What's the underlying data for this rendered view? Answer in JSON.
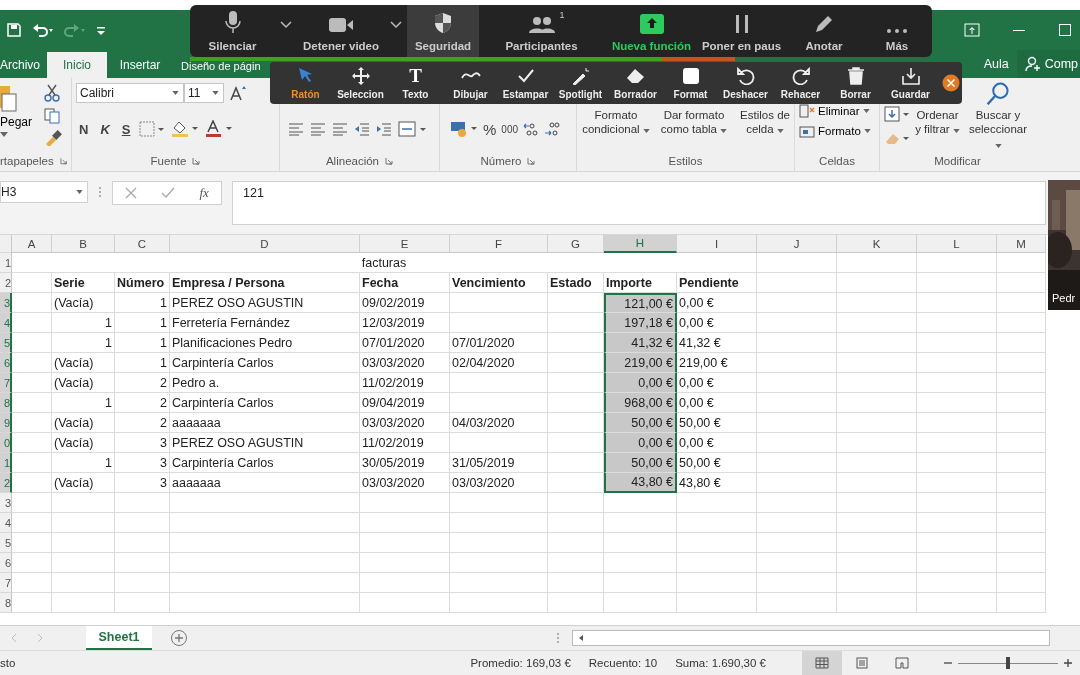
{
  "title_bar": {
    "right_items": [
      "Aula",
      "Comp"
    ]
  },
  "ribbon": {
    "tabs": [
      {
        "label": "Archivo",
        "selected": false
      },
      {
        "label": "Inicio",
        "selected": true
      },
      {
        "label": "Insertar",
        "selected": false
      },
      {
        "label": "Diseño de págin",
        "selected": false
      }
    ],
    "groups": [
      {
        "kind": "clipboard",
        "label": "rtapapeles",
        "launcher": true
      },
      {
        "kind": "font",
        "label": "Fuente",
        "launcher": true
      },
      {
        "kind": "align",
        "label": "Alineación",
        "launcher": true
      },
      {
        "kind": "number",
        "label": "Número",
        "launcher": true
      },
      {
        "kind": "styles",
        "label": "Estilos",
        "launcher": false
      },
      {
        "kind": "cells",
        "label": "Celdas",
        "launcher": false
      },
      {
        "kind": "editing",
        "label": "Modificar",
        "launcher": false
      }
    ],
    "paste": "Pegar",
    "font": {
      "name": "Calibri",
      "size": "11",
      "bold": "N",
      "italic": "K",
      "underline": "S"
    },
    "number": {
      "percent": "%",
      "thousands": "000"
    },
    "styles": [
      "Formato condicional",
      "Dar formato como tabla",
      "Estilos de celda"
    ],
    "cells": [
      "Eliminar",
      "Formato"
    ],
    "editing": [
      "Ordenar y filtrar",
      "Buscar y seleccionar"
    ]
  },
  "formula_bar": {
    "name_box": "H3",
    "fx": "fx",
    "value": "121"
  },
  "sheet": {
    "columns": [
      {
        "label": "A",
        "selected": false
      },
      {
        "label": "B",
        "selected": false
      },
      {
        "label": "C",
        "selected": false
      },
      {
        "label": "D",
        "selected": false
      },
      {
        "label": "E",
        "selected": false
      },
      {
        "label": "F",
        "selected": false
      },
      {
        "label": "G",
        "selected": false
      },
      {
        "label": "H",
        "selected": true
      },
      {
        "label": "I",
        "selected": false
      },
      {
        "label": "J",
        "selected": false
      },
      {
        "label": "K",
        "selected": false
      },
      {
        "label": "L",
        "selected": false
      },
      {
        "label": "M",
        "selected": false
      }
    ],
    "title_row": {
      "number": "1",
      "text": "facturas"
    },
    "header_row": {
      "number": "2",
      "cells": [
        "Serie",
        "Número",
        "Empresa / Persona",
        "Fecha",
        "Vencimiento",
        "Estado",
        "Importe",
        "Pendiente"
      ]
    },
    "rows": [
      {
        "number": "3",
        "serie": {
          "value": "(Vacía)",
          "kind": "text"
        },
        "numero": "1",
        "empresa": "PEREZ OSO AGUSTIN",
        "fecha": "09/02/2019",
        "importe": "121,00 €",
        "pendiente": "0,00 €",
        "selected": true
      },
      {
        "number": "4",
        "serie": {
          "value": "1",
          "kind": "number"
        },
        "numero": "1",
        "empresa": "Ferretería Fernández",
        "fecha": "12/03/2019",
        "importe": "197,18 €",
        "pendiente": "0,00 €",
        "selected": true
      },
      {
        "number": "5",
        "serie": {
          "value": "1",
          "kind": "number"
        },
        "numero": "1",
        "empresa": "Planificaciones Pedro",
        "fecha": "07/01/2020",
        "vencimiento": "07/01/2020",
        "importe": "41,32 €",
        "pendiente": "41,32 €",
        "selected": true
      },
      {
        "number": "6",
        "serie": {
          "value": "(Vacía)",
          "kind": "text"
        },
        "numero": "1",
        "empresa": "Carpintería Carlos",
        "fecha": "03/03/2020",
        "vencimiento": "02/04/2020",
        "importe": "219,00 €",
        "pendiente": "219,00 €",
        "selected": true
      },
      {
        "number": "7",
        "serie": {
          "value": "(Vacía)",
          "kind": "text"
        },
        "numero": "2",
        "empresa": "Pedro a.",
        "fecha": "11/02/2019",
        "importe": "0,00 €",
        "pendiente": "0,00 €",
        "selected": true
      },
      {
        "number": "8",
        "serie": {
          "value": "1",
          "kind": "number"
        },
        "numero": "2",
        "empresa": "Carpintería Carlos",
        "fecha": "09/04/2019",
        "importe": "968,00 €",
        "pendiente": "0,00 €",
        "selected": true
      },
      {
        "number": "9",
        "serie": {
          "value": "(Vacía)",
          "kind": "text"
        },
        "numero": "2",
        "empresa": "aaaaaaa",
        "fecha": "03/03/2020",
        "vencimiento": "04/03/2020",
        "importe": "50,00 €",
        "pendiente": "50,00 €",
        "selected": true
      },
      {
        "number": "0",
        "serie": {
          "value": "(Vacía)",
          "kind": "text"
        },
        "numero": "3",
        "empresa": "PEREZ OSO AGUSTIN",
        "fecha": "11/02/2019",
        "importe": "0,00 €",
        "pendiente": "0,00 €",
        "selected": true
      },
      {
        "number": "1",
        "serie": {
          "value": "1",
          "kind": "number"
        },
        "numero": "3",
        "empresa": "Carpintería Carlos",
        "fecha": "30/05/2019",
        "vencimiento": "31/05/2019",
        "importe": "50,00 €",
        "pendiente": "50,00 €",
        "selected": true
      },
      {
        "number": "2",
        "serie": {
          "value": "(Vacía)",
          "kind": "text"
        },
        "numero": "3",
        "empresa": "aaaaaaa",
        "fecha": "03/03/2020",
        "vencimiento": "03/03/2020",
        "importe": "43,80 €",
        "pendiente": "43,80 €",
        "selected": true
      }
    ],
    "empty_rows": [
      "3",
      "4",
      "5",
      "6",
      "7",
      "8"
    ]
  },
  "sheet_tabs": [
    {
      "label": "Sheet1",
      "selected": true
    }
  ],
  "status_bar": {
    "mode": "sto",
    "average": "Promedio: 169,03 €",
    "count": "Recuento: 10",
    "sum": "Suma: 1.690,30 €",
    "views": [
      {
        "kind": "normal",
        "selected": true
      },
      {
        "kind": "layout",
        "selected": false
      },
      {
        "kind": "break",
        "selected": false
      }
    ],
    "zoom": {
      "level": 0.5
    }
  },
  "meeting_bar": {
    "items": [
      {
        "kind": "mic",
        "label": "Silenciar",
        "caret": true,
        "selected": false
      },
      {
        "kind": "video",
        "label": "Detener video",
        "caret": true,
        "selected": false
      },
      {
        "kind": "shield",
        "label": "Seguridad",
        "caret": false,
        "selected": true
      },
      {
        "kind": "participants",
        "label": "Participantes",
        "badge": "1",
        "caret": false,
        "selected": false
      },
      {
        "kind": "share",
        "label": "Nueva función",
        "caret": false,
        "selected": false
      },
      {
        "kind": "pause",
        "label": "Poner en paus",
        "caret": false,
        "selected": false
      },
      {
        "kind": "pencil",
        "label": "Anotar",
        "caret": false,
        "selected": false
      },
      {
        "kind": "more",
        "label": "Más",
        "caret": false,
        "selected": false
      }
    ]
  },
  "annotation_bar": {
    "tools": [
      {
        "kind": "cursor",
        "label": "Ratón",
        "selected": true
      },
      {
        "kind": "move",
        "label": "Seleccion",
        "selected": false
      },
      {
        "kind": "text",
        "label": "Texto",
        "glyph": "T",
        "selected": false
      },
      {
        "kind": "wave",
        "label": "Dibujar",
        "selected": false
      },
      {
        "kind": "check",
        "label": "Estampar",
        "selected": false
      },
      {
        "kind": "wand",
        "label": "Spotlight",
        "selected": false
      },
      {
        "kind": "eraser",
        "label": "Borrador",
        "selected": false
      },
      {
        "kind": "square",
        "label": "Format",
        "selected": false
      },
      {
        "kind": "undo",
        "label": "Deshacer",
        "selected": false
      },
      {
        "kind": "redo",
        "label": "Rehacer",
        "selected": false
      },
      {
        "kind": "trash",
        "label": "Borrar",
        "selected": false
      },
      {
        "kind": "download",
        "label": "Guardar",
        "selected": false
      }
    ]
  },
  "video_tile": {
    "name": "Pedr"
  }
}
